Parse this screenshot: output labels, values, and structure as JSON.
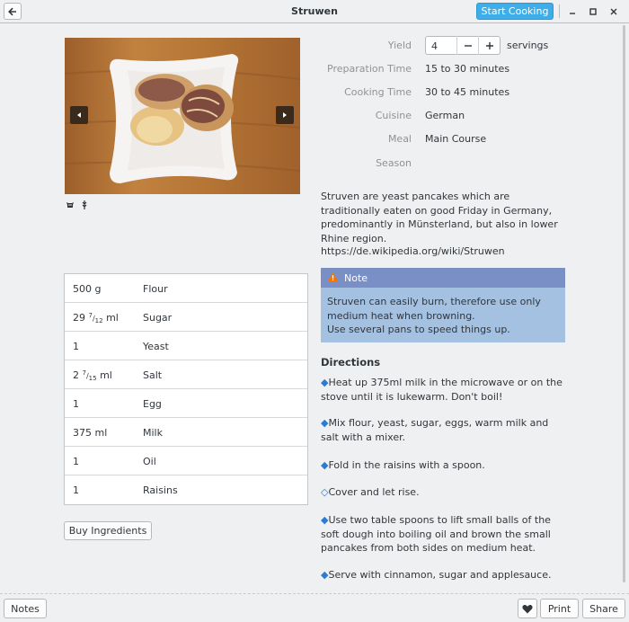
{
  "header": {
    "title": "Struwen",
    "start_cooking": "Start Cooking"
  },
  "meta": {
    "yield_label": "Yield",
    "yield_value": "4",
    "yield_unit": "servings",
    "prep_label": "Preparation Time",
    "prep_value": "15 to 30 minutes",
    "cook_label": "Cooking Time",
    "cook_value": "30 to 45 minutes",
    "cuisine_label": "Cuisine",
    "cuisine_value": "German",
    "meal_label": "Meal",
    "meal_value": "Main Course",
    "season_label": "Season",
    "season_value": ""
  },
  "description": "Struven are yeast pancakes which are traditionally eaten on good Friday in Germany, predominantly in Münsterland, but also in lower Rhine region.",
  "url": "https://de.wikipedia.org/wiki/Struwen",
  "note": {
    "title": "Note",
    "line1": "Struven can easily burn, therefore use only medium heat when browning.",
    "line2": "Use several pans to speed things up."
  },
  "directions": {
    "title": "Directions",
    "steps": [
      {
        "marker": "◆",
        "text": "Heat up 375ml milk in the microwave or on the stove until it is lukewarm. Don't boil!"
      },
      {
        "marker": "◆",
        "text": "Mix flour, yeast, sugar, eggs, warm milk and salt with a mixer."
      },
      {
        "marker": "◆",
        "text": "Fold in the raisins with a spoon."
      },
      {
        "marker": "◇",
        "text": "Cover and let rise."
      },
      {
        "marker": "◆",
        "text": "Use two table spoons to lift small balls of the soft dough into boiling oil and brown the small pancakes from both sides on medium heat."
      },
      {
        "marker": "◆",
        "text": "Serve with cinnamon, sugar and applesauce."
      }
    ]
  },
  "ingredients": [
    {
      "amount": "500 g",
      "name": "Flour"
    },
    {
      "amount_whole": "29",
      "amount_num": "7",
      "amount_den": "12",
      "amount_unit": "ml",
      "name": "Sugar"
    },
    {
      "amount": "1",
      "name": "Yeast"
    },
    {
      "amount_whole": "2",
      "amount_num": "7",
      "amount_den": "15",
      "amount_unit": "ml",
      "name": "Salt"
    },
    {
      "amount": "1",
      "name": "Egg"
    },
    {
      "amount": "375 ml",
      "name": "Milk"
    },
    {
      "amount": "1",
      "name": "Oil"
    },
    {
      "amount": "1",
      "name": "Raisins"
    }
  ],
  "buttons": {
    "buy": "Buy Ingredients",
    "notes": "Notes",
    "print": "Print",
    "share": "Share"
  },
  "colors": {
    "accent": "#3daee9",
    "note_header": "#7b8fc7",
    "note_body": "#a4c1e2"
  }
}
